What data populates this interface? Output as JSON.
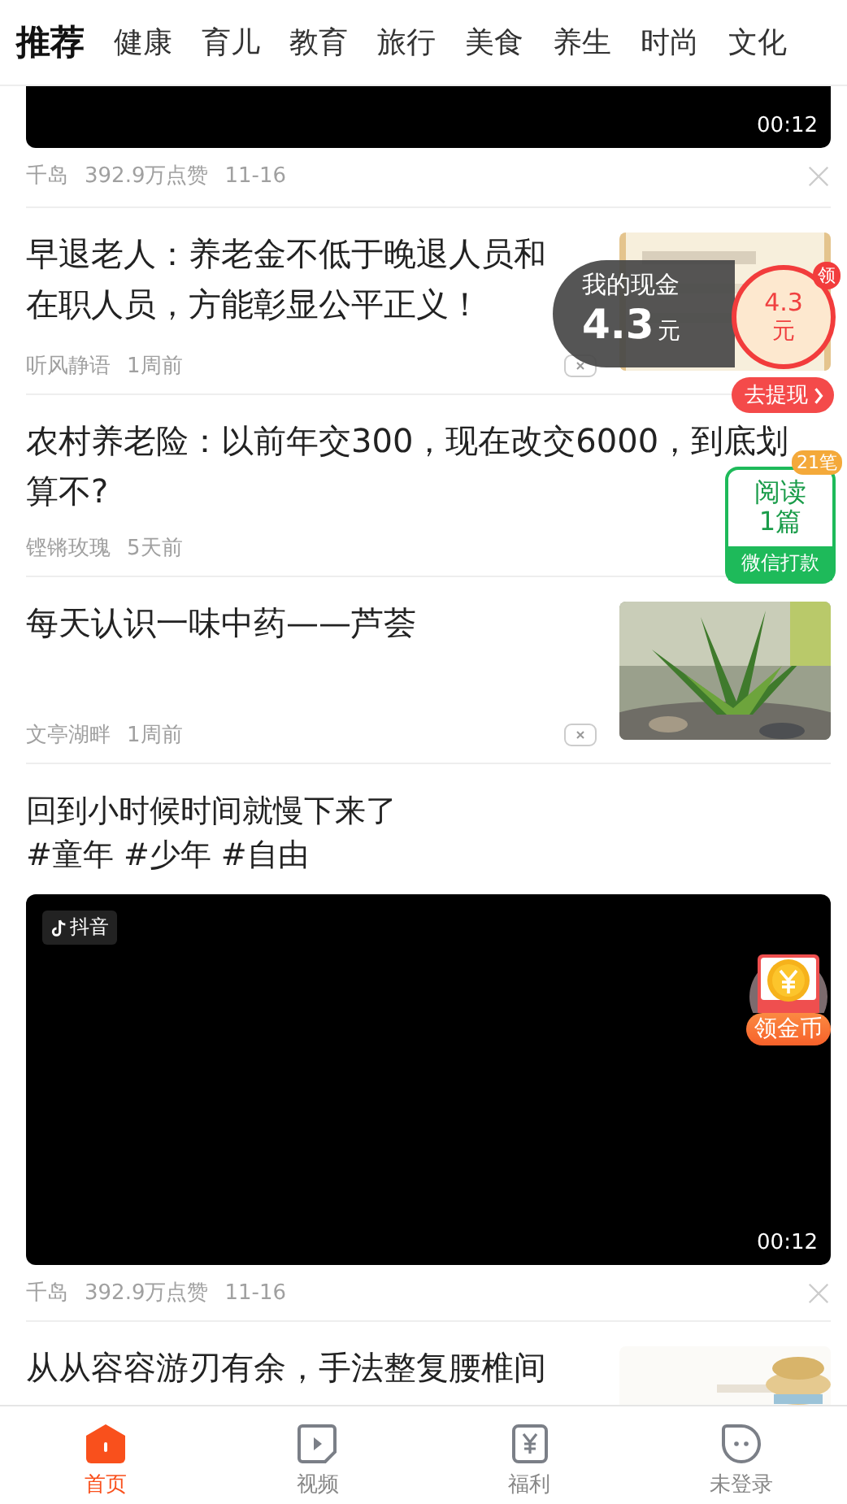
{
  "tabs": [
    {
      "label": "推荐",
      "selected": true
    },
    {
      "label": "健康",
      "selected": false
    },
    {
      "label": "育儿",
      "selected": false
    },
    {
      "label": "教育",
      "selected": false
    },
    {
      "label": "旅行",
      "selected": false
    },
    {
      "label": "美食",
      "selected": false
    },
    {
      "label": "养生",
      "selected": false
    },
    {
      "label": "时尚",
      "selected": false
    },
    {
      "label": "文化",
      "selected": false
    }
  ],
  "feed": [
    {
      "kind": "video_tail",
      "duration": "00:12",
      "meta": [
        "千岛",
        "392.9万点赞",
        "11-16"
      ]
    },
    {
      "kind": "thumb",
      "title": "早退老人：养老金不低于晚退人员和在职人员，方能彰显公平正义！",
      "meta": [
        "听风静语",
        "1周前"
      ]
    },
    {
      "kind": "text",
      "title": "农村养老险：以前年交300，现在改交6000，到底划算不?",
      "meta": [
        "铿锵玫瑰",
        "5天前"
      ]
    },
    {
      "kind": "thumb",
      "title": "每天认识一味中药——芦荟",
      "meta": [
        "文亭湖畔",
        "1周前"
      ]
    },
    {
      "kind": "video",
      "title": "回到小时候时间就慢下来了",
      "tags": "#童年 #少年 #自由",
      "source": "抖音",
      "duration": "00:12",
      "meta": [
        "千岛",
        "392.9万点赞",
        "11-16"
      ]
    },
    {
      "kind": "cut",
      "title": "从从容容游刃有余，手法整复腰椎间"
    }
  ],
  "cash_widget": {
    "label": "我的现金",
    "amount": "4.3",
    "unit": "元",
    "ring_amount": "4.3",
    "ring_unit": "元",
    "badge": "领",
    "button": "去提现"
  },
  "read_widget": {
    "badge": "21笔",
    "line1": "阅读",
    "line2": "1篇",
    "footer": "微信打款"
  },
  "coin_widget": {
    "label": "领金币"
  },
  "bottom_nav": [
    {
      "label": "首页",
      "selected": true
    },
    {
      "label": "视频",
      "selected": false
    },
    {
      "label": "福利",
      "selected": false
    },
    {
      "label": "未登录",
      "selected": false
    }
  ]
}
